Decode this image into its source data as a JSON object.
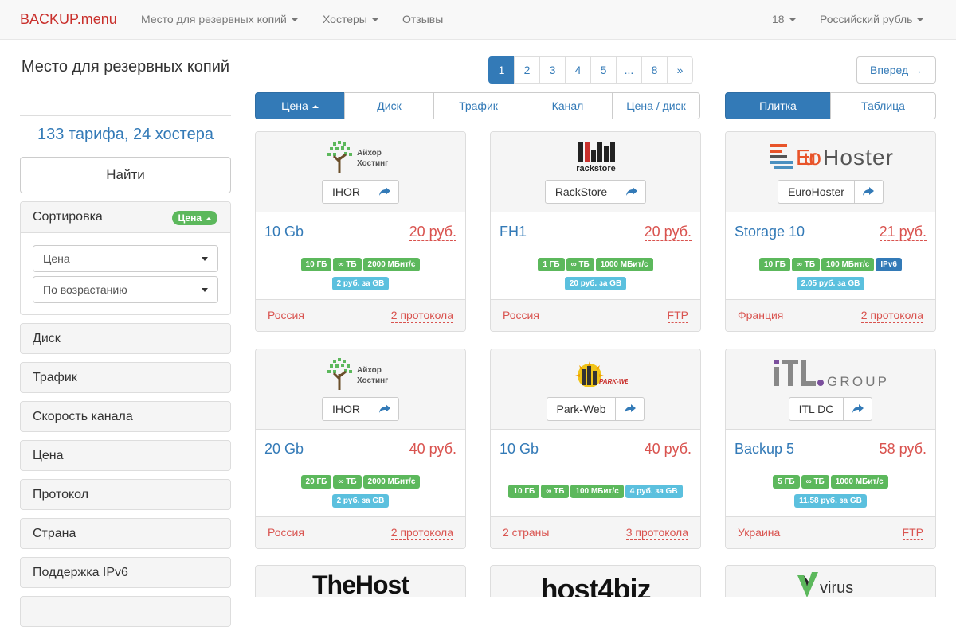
{
  "navbar": {
    "brand": "BACKUP.menu",
    "menu": [
      {
        "label": "Место для резервных копий",
        "dropdown": true
      },
      {
        "label": "Хостеры",
        "dropdown": true
      },
      {
        "label": "Отзывы",
        "dropdown": false
      }
    ],
    "per_page": "18",
    "currency": "Российский рубль"
  },
  "sidebar": {
    "title": "Место для резервных копий",
    "summary": "133 тарифа, 24 хостера",
    "find_button": "Найти",
    "sort": {
      "heading": "Сортировка",
      "badge": "Цена",
      "field_value": "Цена",
      "order_value": "По возрастанию"
    },
    "filters": [
      "Диск",
      "Трафик",
      "Скорость канала",
      "Цена",
      "Протокол",
      "Страна",
      "Поддержка IPv6"
    ]
  },
  "pagination": {
    "pages": [
      "1",
      "2",
      "3",
      "4",
      "5",
      "...",
      "8",
      "»"
    ],
    "active": "1",
    "forward": "Вперед →"
  },
  "sort_tabs": {
    "items": [
      "Цена",
      "Диск",
      "Трафик",
      "Канал",
      "Цена / диск"
    ],
    "active": "Цена"
  },
  "view_tabs": {
    "items": [
      "Плитка",
      "Таблица"
    ],
    "active": "Плитка"
  },
  "cards": [
    {
      "host": "IHOR",
      "logo_text": "Айхор Хостинг",
      "tariff": "10 Gb",
      "price": "20 руб.",
      "badges": [
        [
          "10 ГБ",
          "∞ ТБ",
          "2000 МБит/с"
        ],
        [
          "2 руб. за GB"
        ]
      ],
      "country": "Россия",
      "protocols": "2 протокола"
    },
    {
      "host": "RackStore",
      "logo_text": "rackstore",
      "tariff": "FH1",
      "price": "20 руб.",
      "badges": [
        [
          "1 ГБ",
          "∞ ТБ",
          "1000 МБит/с"
        ],
        [
          "20 руб. за GB"
        ]
      ],
      "country": "Россия",
      "protocols": "FTP"
    },
    {
      "host": "EuroHoster",
      "logo_text": "EuroHoster",
      "tariff": "Storage 10",
      "price": "21 руб.",
      "badges": [
        [
          "10 ГБ",
          "∞ ТБ",
          "100 МБит/с",
          "IPv6"
        ],
        [
          "2.05 руб. за GB"
        ]
      ],
      "country": "Франция",
      "protocols": "2 протокола"
    },
    {
      "host": "IHOR",
      "logo_text": "Айхор Хостинг",
      "tariff": "20 Gb",
      "price": "40 руб.",
      "badges": [
        [
          "20 ГБ",
          "∞ ТБ",
          "2000 МБит/с"
        ],
        [
          "2 руб. за GB"
        ]
      ],
      "country": "Россия",
      "protocols": "2 протокола"
    },
    {
      "host": "Park-Web",
      "logo_text": "PARK-WEB",
      "tariff": "10 Gb",
      "price": "40 руб.",
      "badges": [
        [
          "10 ГБ",
          "∞ ТБ",
          "100 МБит/с",
          "4 руб. за GB"
        ]
      ],
      "country": "2 страны",
      "protocols": "3 протокола"
    },
    {
      "host": "ITL DC",
      "logo_text": "ITL.GROUP",
      "tariff": "Backup 5",
      "price": "58 руб.",
      "badges": [
        [
          "5 ГБ",
          "∞ ТБ",
          "1000 МБит/с"
        ],
        [
          "11.58 руб. за GB"
        ]
      ],
      "country": "Украина",
      "protocols": "FTP"
    }
  ],
  "partial_logos": [
    "TheHost",
    "host4biz",
    "virus"
  ],
  "colors": {
    "primary": "#337ab7",
    "brand": "#c9302c",
    "price": "#d9534f",
    "badge_green": "#5cb85c",
    "badge_info": "#5bc0de",
    "badge_ipv6": "#337ab7"
  }
}
